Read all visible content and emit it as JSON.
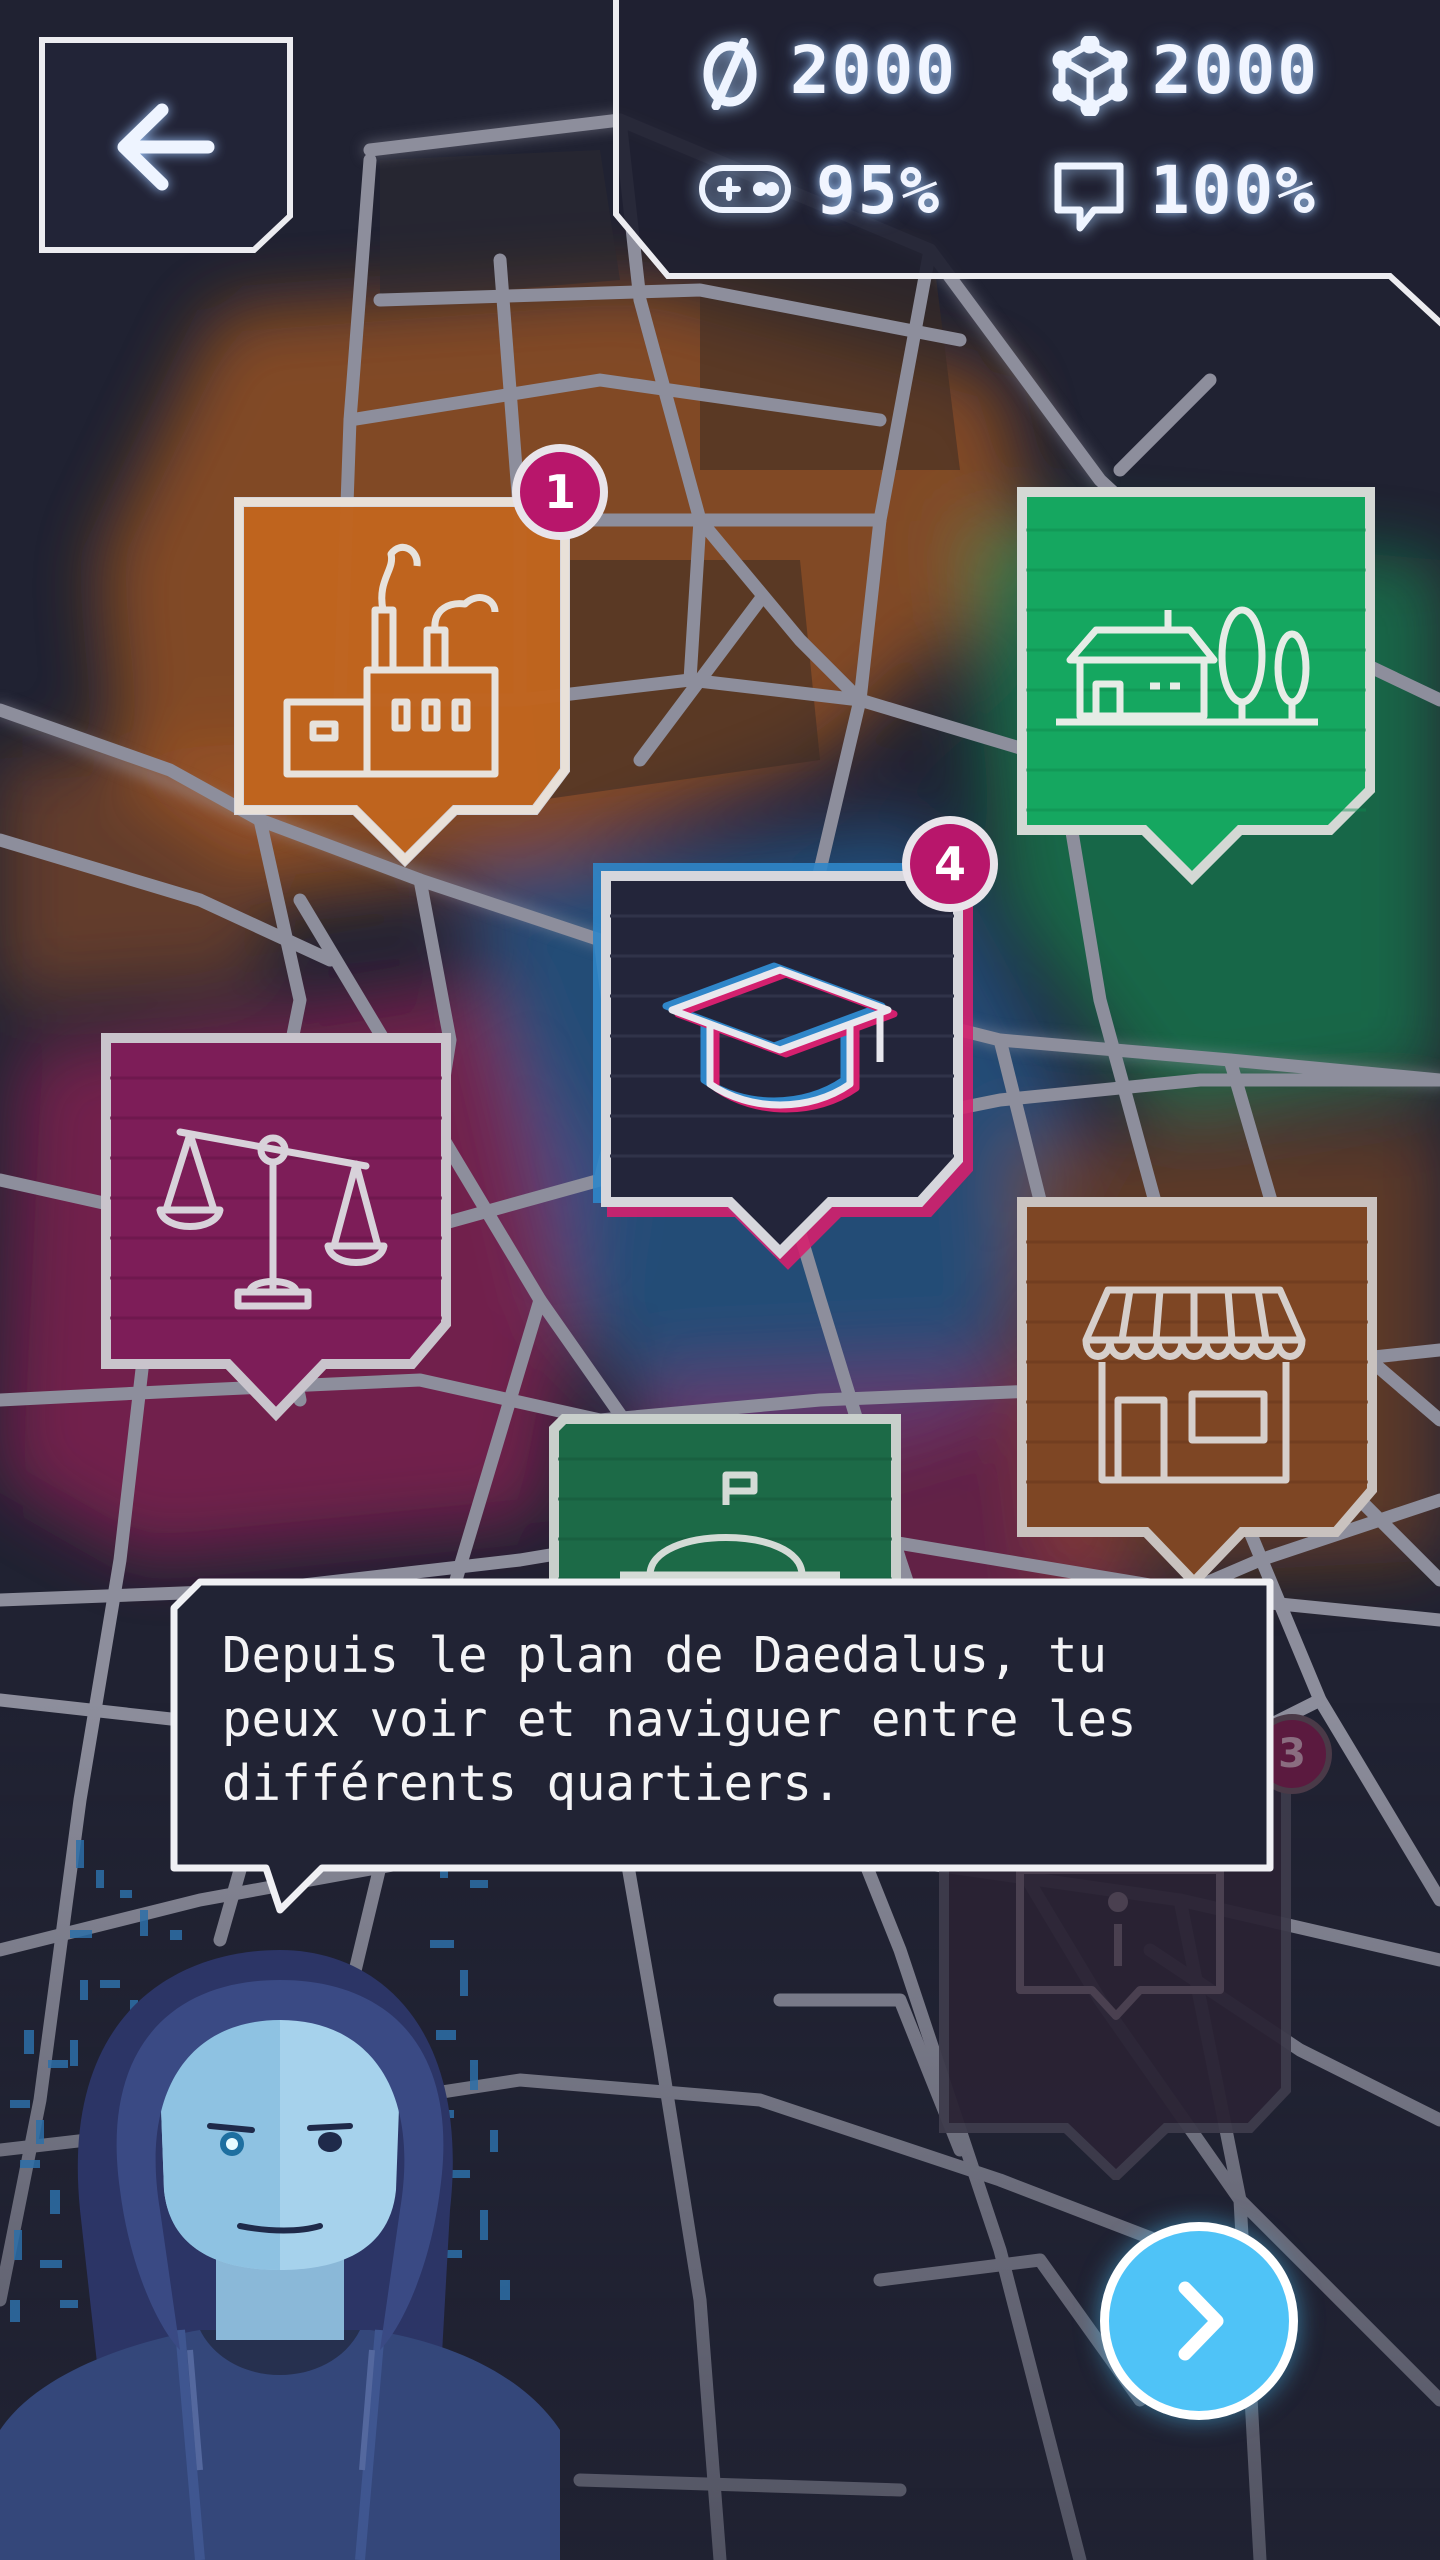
{
  "hud": {
    "stats": [
      {
        "icon": "currency-icon",
        "value": "2000"
      },
      {
        "icon": "cube-icon",
        "value": "2000"
      },
      {
        "icon": "gamepad-icon",
        "value": "95%"
      },
      {
        "icon": "chat-icon",
        "value": "100%"
      }
    ]
  },
  "districts": [
    {
      "name": "industrial-district",
      "icon": "factory-icon",
      "color": "#c8651e",
      "badge": "1"
    },
    {
      "name": "nature-district",
      "icon": "house-trees-icon",
      "color": "#17a35e",
      "badge": ""
    },
    {
      "name": "education-district",
      "icon": "graduation-cap-icon",
      "color": "#2b2d42",
      "badge": "4"
    },
    {
      "name": "justice-district",
      "icon": "scales-icon",
      "color": "#8a2060",
      "badge": ""
    },
    {
      "name": "commerce-district",
      "icon": "storefront-icon",
      "color": "#8a4a25",
      "badge": ""
    },
    {
      "name": "restaurant-district",
      "icon": "cloche-icon",
      "color": "#1d6e4a",
      "badge": ""
    },
    {
      "name": "information-district",
      "icon": "info-bubble-icon",
      "color": "#3a2a40",
      "badge": "3"
    }
  ],
  "dialog": {
    "text": "Depuis le plan de Daedalus, tu peux voir et naviguer entre les différents quartiers."
  },
  "colors": {
    "background": "#202232",
    "road": "#8d8e9c",
    "orange_glow": "#d9742a",
    "green_glow": "#1fbf6b",
    "pink_glow": "#d4206e",
    "blue_glow": "#2f86c9",
    "badge": "#b8166b",
    "next_button": "#4fc3f7"
  }
}
